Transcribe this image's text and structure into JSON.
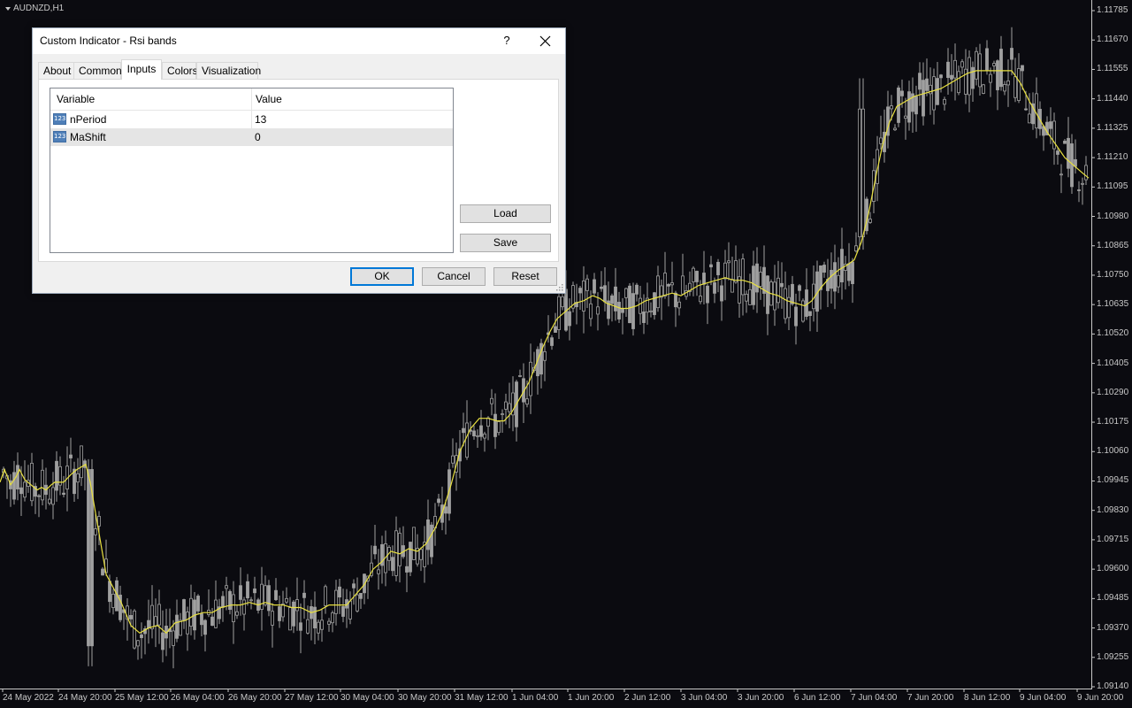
{
  "chart": {
    "symbol": "AUDNZD,H1",
    "colors": {
      "background": "#0b0b10",
      "candle": "#a0a0a0",
      "ma_line": "#e8e040",
      "axis_text": "#c8c8c8"
    },
    "price_axis": [
      "1.11785",
      "1.11670",
      "1.11555",
      "1.11440",
      "1.11325",
      "1.11210",
      "1.11095",
      "1.10980",
      "1.10865",
      "1.10750",
      "1.10635",
      "1.10520",
      "1.10405",
      "1.10290",
      "1.10175",
      "1.10060",
      "1.09945",
      "1.09830",
      "1.09715",
      "1.09600",
      "1.09485",
      "1.09370",
      "1.09255",
      "1.09140"
    ],
    "time_axis": [
      "24 May 2022",
      "24 May 20:00",
      "25 May 12:00",
      "26 May 04:00",
      "26 May 20:00",
      "27 May 12:00",
      "30 May 04:00",
      "30 May 20:00",
      "31 May 12:00",
      "1 Jun 04:00",
      "1 Jun 20:00",
      "2 Jun 12:00",
      "3 Jun 04:00",
      "3 Jun 20:00",
      "6 Jun 12:00",
      "7 Jun 04:00",
      "7 Jun 20:00",
      "8 Jun 12:00",
      "9 Jun 04:00",
      "9 Jun 20:00"
    ],
    "ma_path": [
      [
        1.0994,
        0
      ],
      [
        1.0999,
        5
      ],
      [
        1.0993,
        12
      ],
      [
        1.0996,
        18
      ],
      [
        1.0999,
        22
      ],
      [
        1.0995,
        28
      ],
      [
        1.0993,
        35
      ],
      [
        1.0991,
        42
      ],
      [
        1.0992,
        47
      ],
      [
        1.0991,
        52
      ],
      [
        1.0993,
        58
      ],
      [
        1.0994,
        62
      ],
      [
        1.0994,
        66
      ],
      [
        1.0994,
        72
      ],
      [
        1.0997,
        80
      ],
      [
        1.0999,
        87
      ],
      [
        1.1001,
        97
      ],
      [
        1.0994,
        102
      ],
      [
        1.0958,
        120
      ],
      [
        1.0947,
        137
      ],
      [
        1.0938,
        148
      ],
      [
        1.0935,
        158
      ],
      [
        1.0937,
        168
      ],
      [
        1.0938,
        178
      ],
      [
        1.0935,
        188
      ],
      [
        1.0939,
        198
      ],
      [
        1.094,
        210
      ],
      [
        1.0942,
        220
      ],
      [
        1.0943,
        230
      ],
      [
        1.0943,
        240
      ],
      [
        1.0945,
        250
      ],
      [
        1.0946,
        262
      ],
      [
        1.0946,
        272
      ],
      [
        1.0947,
        282
      ],
      [
        1.0946,
        292
      ],
      [
        1.0947,
        300
      ],
      [
        1.0946,
        310
      ],
      [
        1.0946,
        320
      ],
      [
        1.0945,
        330
      ],
      [
        1.0945,
        340
      ],
      [
        1.0943,
        352
      ],
      [
        1.0944,
        362
      ],
      [
        1.0946,
        372
      ],
      [
        1.0946,
        382
      ],
      [
        1.0946,
        392
      ],
      [
        1.095,
        402
      ],
      [
        1.0954,
        412
      ],
      [
        1.096,
        422
      ],
      [
        1.0963,
        432
      ],
      [
        1.0967,
        442
      ],
      [
        1.0966,
        452
      ],
      [
        1.0968,
        462
      ],
      [
        1.0967,
        472
      ],
      [
        1.097,
        482
      ],
      [
        1.0976,
        492
      ],
      [
        1.0982,
        500
      ],
      [
        1.0993,
        510
      ],
      [
        1.1006,
        520
      ],
      [
        1.1015,
        532
      ],
      [
        1.1019,
        542
      ],
      [
        1.1019,
        552
      ],
      [
        1.1018,
        562
      ],
      [
        1.1018,
        570
      ],
      [
        1.1021,
        578
      ],
      [
        1.1027,
        588
      ],
      [
        1.1033,
        598
      ],
      [
        1.104,
        606
      ],
      [
        1.1047,
        614
      ],
      [
        1.1053,
        622
      ],
      [
        1.1058,
        630
      ],
      [
        1.1061,
        640
      ],
      [
        1.1064,
        650
      ],
      [
        1.1065,
        660
      ],
      [
        1.1067,
        670
      ],
      [
        1.1066,
        678
      ],
      [
        1.1064,
        686
      ],
      [
        1.1063,
        694
      ],
      [
        1.1062,
        702
      ],
      [
        1.1062,
        710
      ],
      [
        1.1063,
        720
      ],
      [
        1.1065,
        730
      ],
      [
        1.1066,
        740
      ],
      [
        1.1067,
        750
      ],
      [
        1.1068,
        760
      ],
      [
        1.1067,
        770
      ],
      [
        1.1069,
        780
      ],
      [
        1.1071,
        790
      ],
      [
        1.1072,
        800
      ],
      [
        1.1073,
        810
      ],
      [
        1.1074,
        820
      ],
      [
        1.1073,
        830
      ],
      [
        1.1073,
        840
      ],
      [
        1.1072,
        850
      ],
      [
        1.107,
        860
      ],
      [
        1.1068,
        870
      ],
      [
        1.1067,
        880
      ],
      [
        1.1065,
        890
      ],
      [
        1.1064,
        900
      ],
      [
        1.1063,
        910
      ],
      [
        1.1065,
        918
      ],
      [
        1.107,
        928
      ],
      [
        1.1074,
        938
      ],
      [
        1.1077,
        948
      ],
      [
        1.1079,
        958
      ],
      [
        1.1081,
        966
      ],
      [
        1.1088,
        974
      ],
      [
        1.1099,
        982
      ],
      [
        1.1113,
        990
      ],
      [
        1.1126,
        998
      ],
      [
        1.1135,
        1006
      ],
      [
        1.1141,
        1014
      ],
      [
        1.1143,
        1024
      ],
      [
        1.1145,
        1034
      ],
      [
        1.1146,
        1044
      ],
      [
        1.1147,
        1054
      ],
      [
        1.1148,
        1064
      ],
      [
        1.115,
        1074
      ],
      [
        1.1152,
        1084
      ],
      [
        1.1154,
        1094
      ],
      [
        1.1155,
        1104
      ],
      [
        1.1155,
        1114
      ],
      [
        1.1155,
        1124
      ],
      [
        1.1155,
        1134
      ],
      [
        1.1155,
        1144
      ],
      [
        1.115,
        1154
      ],
      [
        1.1143,
        1164
      ],
      [
        1.1137,
        1174
      ],
      [
        1.1131,
        1184
      ],
      [
        1.1126,
        1194
      ],
      [
        1.1121,
        1204
      ],
      [
        1.1118,
        1214
      ],
      [
        1.1115,
        1224
      ],
      [
        1.1113,
        1231
      ]
    ]
  },
  "dialog": {
    "title": "Custom Indicator - Rsi bands",
    "help_label": "?",
    "tabs": [
      "About",
      "Common",
      "Inputs",
      "Colors",
      "Visualization"
    ],
    "active_tab": "Inputs",
    "table": {
      "headers": [
        "Variable",
        "Value"
      ],
      "rows": [
        {
          "icon": "123",
          "variable": "nPeriod",
          "value": "13"
        },
        {
          "icon": "123",
          "variable": "MaShift",
          "value": "0"
        }
      ]
    },
    "buttons": {
      "load": "Load",
      "save": "Save",
      "ok": "OK",
      "cancel": "Cancel",
      "reset": "Reset"
    }
  }
}
